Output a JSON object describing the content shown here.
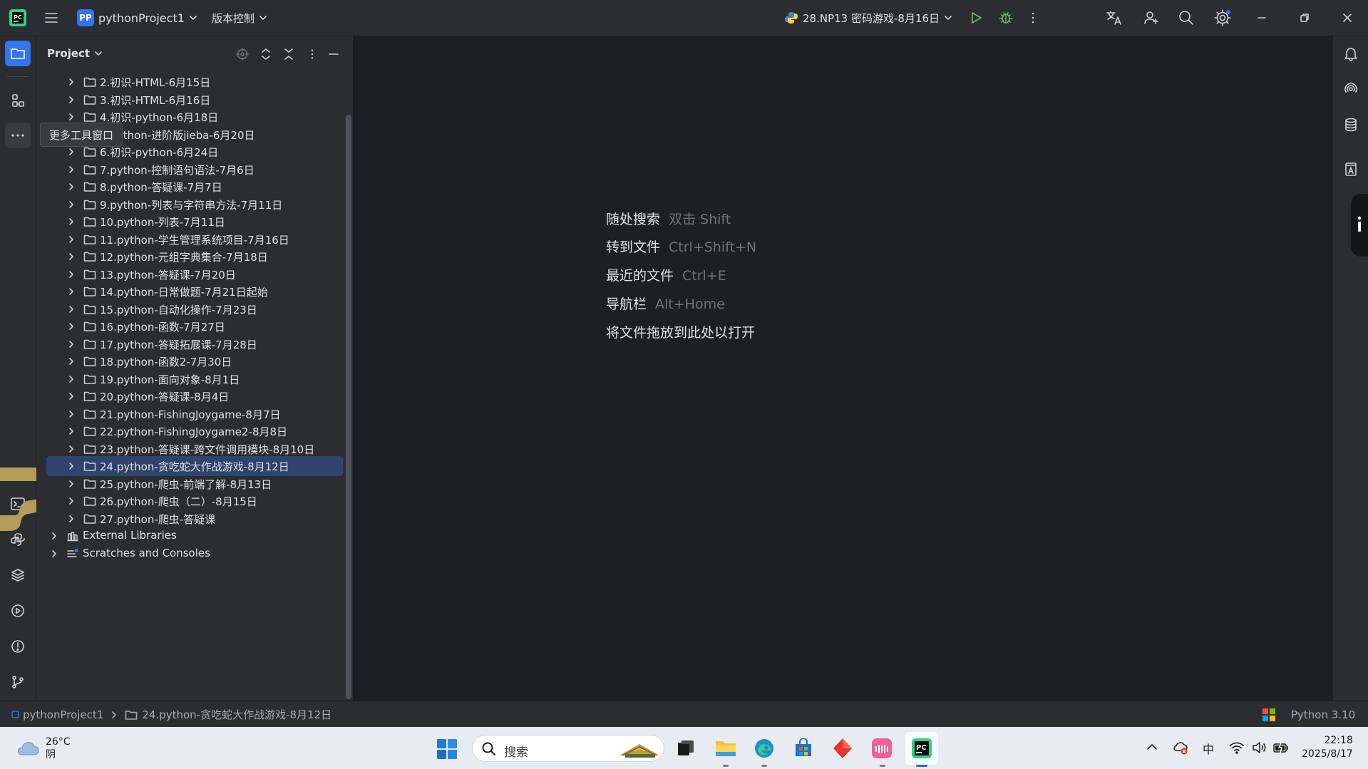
{
  "titlebar": {
    "project_badge": "PP",
    "project_name": "pythonProject1",
    "vcs_label": "版本控制",
    "run_config": "28.NP13 密码游戏-8月16日"
  },
  "project_panel": {
    "title": "Project",
    "items": [
      {
        "label": "2.初识-HTML-6月15日"
      },
      {
        "label": "3.初识-HTML-6月16日"
      },
      {
        "label": "4.初识-python-6月18日"
      },
      {
        "label": "5.python-进阶版jieba-6月20日"
      },
      {
        "label": "6.初识-python-6月24日"
      },
      {
        "label": "7.python-控制语句语法-7月6日"
      },
      {
        "label": "8.python-答疑课-7月7日"
      },
      {
        "label": "9.python-列表与字符串方法-7月11日"
      },
      {
        "label": "10.python-列表-7月11日"
      },
      {
        "label": "11.python-学生管理系统项目-7月16日"
      },
      {
        "label": "12.python-元组字典集合-7月18日"
      },
      {
        "label": "13.python-答疑课-7月20日"
      },
      {
        "label": "14.python-日常做题-7月21日起始"
      },
      {
        "label": "15.python-自动化操作-7月23日"
      },
      {
        "label": "16.python-函数-7月27日"
      },
      {
        "label": "17.python-答疑拓展课-7月28日"
      },
      {
        "label": "18.python-函数2-7月30日"
      },
      {
        "label": "19.python-面向对象-8月1日"
      },
      {
        "label": "20.python-答疑课-8月4日"
      },
      {
        "label": "21.python-FishingJoygame-8月7日"
      },
      {
        "label": "22.python-FishingJoygame2-8月8日"
      },
      {
        "label": "23.python-答疑课-跨文件调用模块-8月10日"
      },
      {
        "label": "24.python-贪吃蛇大作战游戏-8月12日"
      },
      {
        "label": "25.python-爬虫-前端了解-8月13日"
      },
      {
        "label": "26.python-爬虫（二）-8月15日"
      },
      {
        "label": "27.python-爬虫-答疑课"
      }
    ],
    "selected_index": 22,
    "external_libraries": "External Libraries",
    "scratches": "Scratches and Consoles"
  },
  "tooltip": "更多工具窗口",
  "editor_hints": [
    {
      "action": "随处搜索",
      "shortcut": "双击 Shift"
    },
    {
      "action": "转到文件",
      "shortcut": "Ctrl+Shift+N"
    },
    {
      "action": "最近的文件",
      "shortcut": "Ctrl+E"
    },
    {
      "action": "导航栏",
      "shortcut": "Alt+Home"
    },
    {
      "action": "将文件拖放到此处以打开",
      "shortcut": ""
    }
  ],
  "statusbar": {
    "breadcrumb_project": "pythonProject1",
    "breadcrumb_folder": "24.python-贪吃蛇大作战游戏-8月12日",
    "interpreter": "Python 3.10"
  },
  "taskbar": {
    "weather_temp": "26°C",
    "weather_desc": "阴",
    "search_placeholder": "搜索",
    "ime": "中",
    "time": "22:18",
    "date": "2025/8/17"
  },
  "colors": {
    "accent": "#3574f0",
    "selection": "#2e436e",
    "panel_bg": "#2b2d30",
    "editor_bg": "#1e1f22",
    "run_green": "#5fb865"
  }
}
